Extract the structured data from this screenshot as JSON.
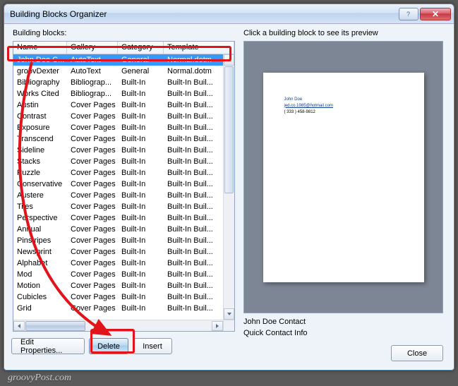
{
  "window_title": "Building Blocks Organizer",
  "labels": {
    "building_blocks": "Building blocks:",
    "preview_hint": "Click a building block to see its preview"
  },
  "columns": [
    "Name",
    "Gallery",
    "Category",
    "Template"
  ],
  "rows": [
    {
      "name": "John Doe C...",
      "gallery": "AutoText",
      "category": "General",
      "template": "Normal.dotm",
      "selected": true
    },
    {
      "name": "groovDexter",
      "gallery": "AutoText",
      "category": "General",
      "template": "Normal.dotm"
    },
    {
      "name": "Bibliography",
      "gallery": "Bibliograp...",
      "category": "Built-In",
      "template": "Built-In Buil..."
    },
    {
      "name": "Works Cited",
      "gallery": "Bibliograp...",
      "category": "Built-In",
      "template": "Built-In Buil..."
    },
    {
      "name": "Austin",
      "gallery": "Cover Pages",
      "category": "Built-In",
      "template": "Built-In Buil..."
    },
    {
      "name": "Contrast",
      "gallery": "Cover Pages",
      "category": "Built-In",
      "template": "Built-In Buil..."
    },
    {
      "name": "Exposure",
      "gallery": "Cover Pages",
      "category": "Built-In",
      "template": "Built-In Buil..."
    },
    {
      "name": "Transcend",
      "gallery": "Cover Pages",
      "category": "Built-In",
      "template": "Built-In Buil..."
    },
    {
      "name": "Sideline",
      "gallery": "Cover Pages",
      "category": "Built-In",
      "template": "Built-In Buil..."
    },
    {
      "name": "Stacks",
      "gallery": "Cover Pages",
      "category": "Built-In",
      "template": "Built-In Buil..."
    },
    {
      "name": "Puzzle",
      "gallery": "Cover Pages",
      "category": "Built-In",
      "template": "Built-In Buil..."
    },
    {
      "name": "Conservative",
      "gallery": "Cover Pages",
      "category": "Built-In",
      "template": "Built-In Buil..."
    },
    {
      "name": "Austere",
      "gallery": "Cover Pages",
      "category": "Built-In",
      "template": "Built-In Buil..."
    },
    {
      "name": "Tiles",
      "gallery": "Cover Pages",
      "category": "Built-In",
      "template": "Built-In Buil..."
    },
    {
      "name": "Perspective",
      "gallery": "Cover Pages",
      "category": "Built-In",
      "template": "Built-In Buil..."
    },
    {
      "name": "Annual",
      "gallery": "Cover Pages",
      "category": "Built-In",
      "template": "Built-In Buil..."
    },
    {
      "name": "Pinstripes",
      "gallery": "Cover Pages",
      "category": "Built-In",
      "template": "Built-In Buil..."
    },
    {
      "name": "Newsprint",
      "gallery": "Cover Pages",
      "category": "Built-In",
      "template": "Built-In Buil..."
    },
    {
      "name": "Alphabet",
      "gallery": "Cover Pages",
      "category": "Built-In",
      "template": "Built-In Buil..."
    },
    {
      "name": "Mod",
      "gallery": "Cover Pages",
      "category": "Built-In",
      "template": "Built-In Buil..."
    },
    {
      "name": "Motion",
      "gallery": "Cover Pages",
      "category": "Built-In",
      "template": "Built-In Buil..."
    },
    {
      "name": "Cubicles",
      "gallery": "Cover Pages",
      "category": "Built-In",
      "template": "Built-In Buil..."
    },
    {
      "name": "Grid",
      "gallery": "Cover Pages",
      "category": "Built-In",
      "template": "Built-In Buil..."
    }
  ],
  "buttons": {
    "edit_properties": "Edit Properties...",
    "delete": "Delete",
    "insert": "Insert",
    "close": "Close"
  },
  "preview": {
    "name": "John Doe Contact",
    "description": "Quick Contact Info",
    "page_name": "John Doe",
    "page_email": "jed.co.1985@hotmail.com",
    "page_phone": "( 333 ) 458-9812"
  },
  "watermark": "groovyPost.com"
}
